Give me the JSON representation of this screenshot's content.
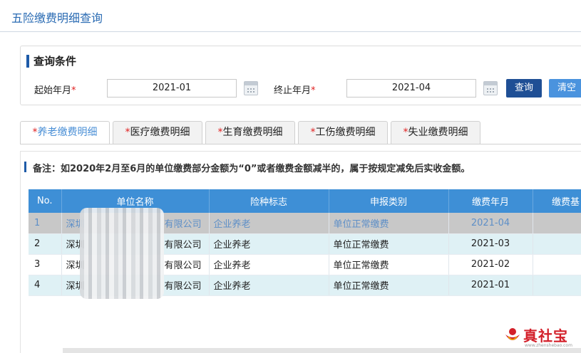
{
  "page": {
    "title": "五险缴费明细查询"
  },
  "query": {
    "section_title": "查询条件",
    "start_label": "起始年月",
    "start_value": "2021-01",
    "end_label": "终止年月",
    "end_value": "2021-04",
    "required_mark": "*",
    "query_button": "查询",
    "clear_button": "清空"
  },
  "tabs": [
    {
      "label": "养老缴费明细",
      "active": true
    },
    {
      "label": "医疗缴费明细",
      "active": false
    },
    {
      "label": "生育缴费明细",
      "active": false
    },
    {
      "label": "工伤缴费明细",
      "active": false
    },
    {
      "label": "失业缴费明细",
      "active": false
    }
  ],
  "note": "备注：如2020年2月至6月的单位缴费部分金额为“0”或者缴费金额减半的，属于按规定减免后实收金额。",
  "table": {
    "headers": [
      "No.",
      "单位名称",
      "险种标志",
      "申报类别",
      "缴费年月",
      "缴费基"
    ],
    "rows": [
      {
        "no": "1",
        "company_start": "深圳",
        "company_end": "有限公司",
        "insurance": "企业养老",
        "category": "单位正常缴费",
        "month": "2021-04"
      },
      {
        "no": "2",
        "company_start": "深圳",
        "company_end": "有限公司",
        "insurance": "企业养老",
        "category": "单位正常缴费",
        "month": "2021-03"
      },
      {
        "no": "3",
        "company_start": "深圳",
        "company_end": "有限公司",
        "insurance": "企业养老",
        "category": "单位正常缴费",
        "month": "2021-02"
      },
      {
        "no": "4",
        "company_start": "深圳",
        "company_end": "有限公司",
        "insurance": "企业养老",
        "category": "单位正常缴费",
        "month": "2021-01"
      }
    ]
  },
  "watermark": {
    "brand": "真社宝",
    "url": "www.zhenshebao.com"
  },
  "colors": {
    "accent": "#1e5ba8",
    "header": "#3e8fd6",
    "required": "#e02020"
  }
}
